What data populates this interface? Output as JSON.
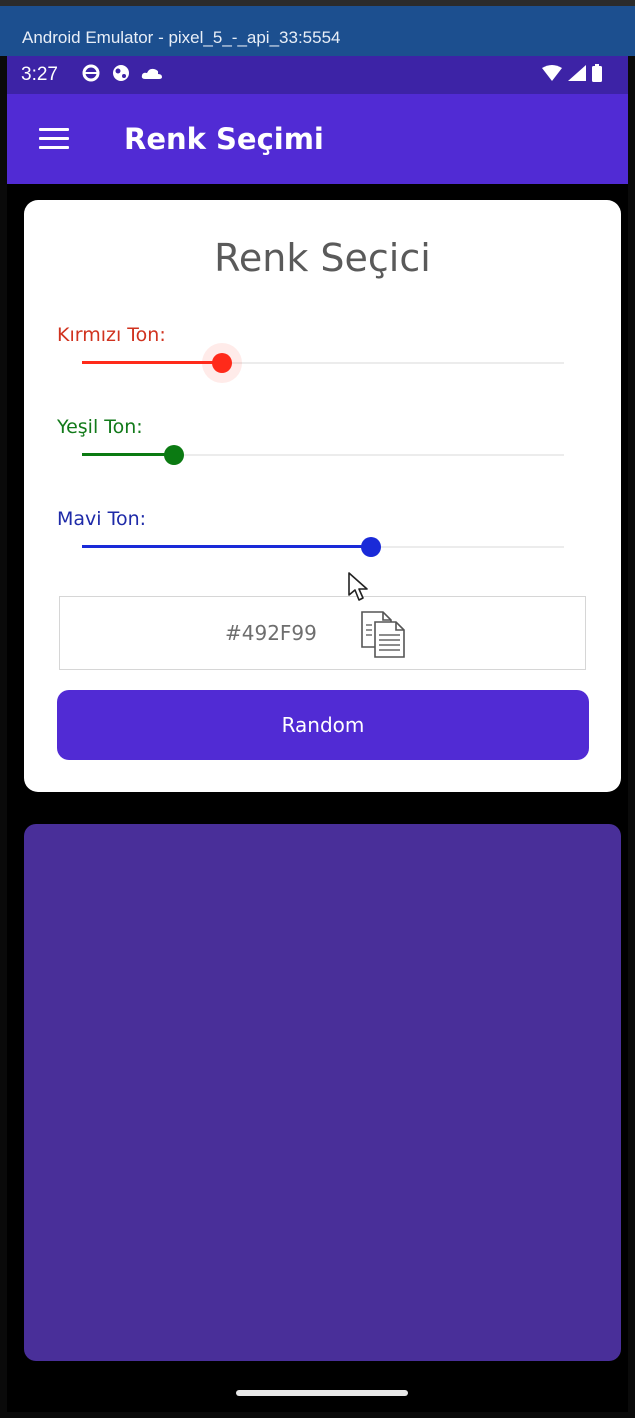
{
  "window": {
    "title": "Android Emulator - pixel_5_-_api_33:5554"
  },
  "status_bar": {
    "time": "3:27",
    "icons": [
      "settings-gear-icon",
      "network-globe-icon",
      "cloud-icon",
      "wifi-icon",
      "signal-icon",
      "battery-icon"
    ]
  },
  "app_bar": {
    "title": "Renk Seçimi",
    "menu_icon": "hamburger-menu-icon"
  },
  "picker": {
    "title": "Renk Seçici",
    "sliders": [
      {
        "label": "Kırmızı Ton:",
        "value_fraction": 0.29,
        "color": "#ff2a1a",
        "label_color": "#d0331f"
      },
      {
        "label": "Yeşil Ton:",
        "value_fraction": 0.19,
        "color": "#0b7a12",
        "label_color": "#127a1a"
      },
      {
        "label": "Mavi Ton:",
        "value_fraction": 0.6,
        "color": "#1a2ad8",
        "label_color": "#1e2aa8"
      }
    ],
    "hex_value": "#492F99",
    "copy_icon": "copy-clipboard-icon",
    "random_label": "Random"
  },
  "preview": {
    "color": "#492F99"
  },
  "colors": {
    "accent": "#512bd4",
    "status_bar": "#3d23a6"
  }
}
